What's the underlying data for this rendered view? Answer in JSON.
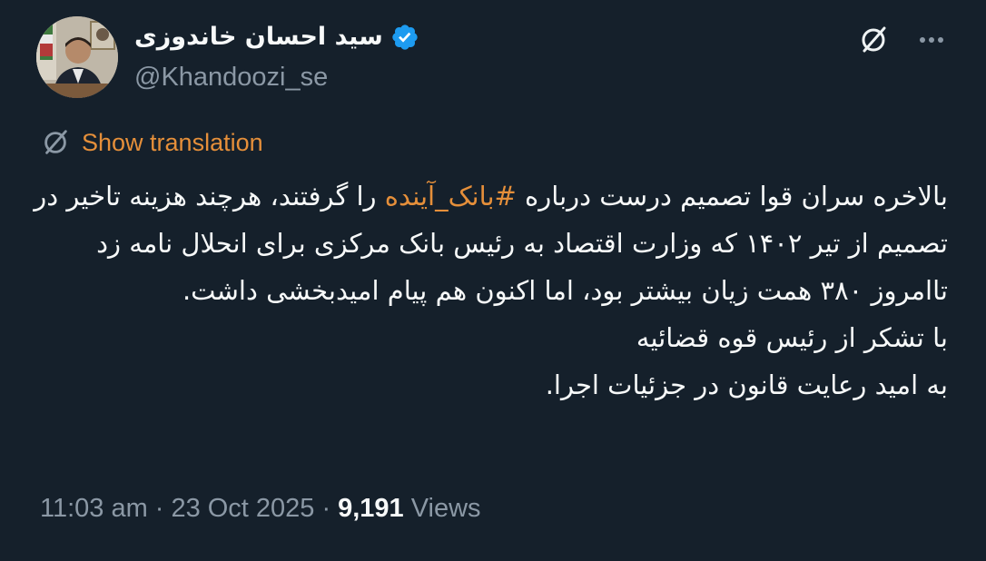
{
  "author": {
    "display_name": "سید احسان خاندوزی",
    "handle": "@Khandoozi_se",
    "verified": true,
    "verified_color": "#1d9bf0"
  },
  "translate": {
    "label": "Show translation",
    "icon": "globe-icon",
    "color": "#e58f3a"
  },
  "tweet": {
    "line1_before": "بالاخره سران قوا تصمیم درست درباره ",
    "hashtag": "#بانک_آینده",
    "line1_after": " را گرفتند، هرچند هزینه تاخیر در تصمیم از تیر ۱۴۰۲ که وزارت اقتصاد به رئیس بانک مرکزی برای انحلال نامه زد تاامروز ۳۸۰ همت زیان بیشتر بود، اما اکنون هم پیام امیدبخشی داشت.",
    "line2": "با تشکر از رئیس قوه قضائیه",
    "line3": "به امید رعایت قانون در جزئیات اجرا."
  },
  "meta": {
    "time": "11:03 am",
    "separator": "·",
    "date": "23 Oct 2025",
    "views_count": "9,191",
    "views_label": "Views"
  },
  "colors": {
    "background": "#15202b",
    "primary_text": "#f7f9f9",
    "secondary_text": "#8b98a5",
    "accent": "#e58f3a"
  }
}
